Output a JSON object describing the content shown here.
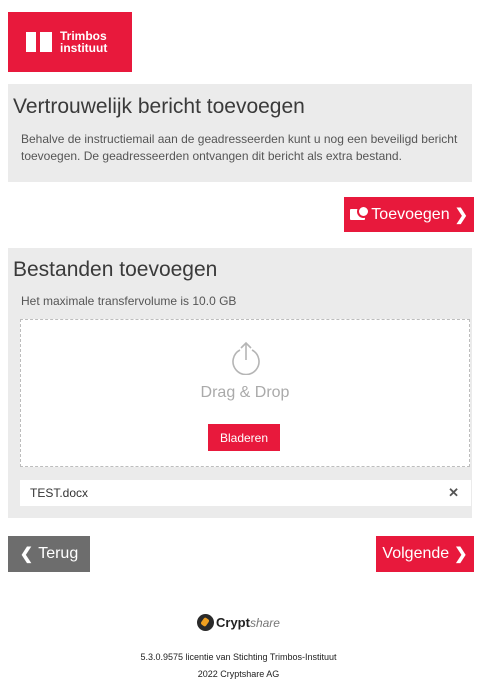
{
  "logo": {
    "line1": "Trimbos",
    "line2": "instituut"
  },
  "message_section": {
    "title": "Vertrouwelijk bericht toevoegen",
    "description": "Behalve de instructiemail aan de geadresseerden kunt u nog een beveiligd bericht toevoegen. De geadresseerden ontvangen dit bericht als extra bestand.",
    "add_button_label": "Toevoegen"
  },
  "files_section": {
    "title": "Bestanden toevoegen",
    "max_volume": "Het maximale transfervolume is 10.0 GB",
    "dropzone_text": "Drag & Drop",
    "browse_button_label": "Bladeren",
    "files": [
      {
        "name": "TEST.docx"
      }
    ]
  },
  "nav": {
    "back_label": "Terug",
    "next_label": "Volgende"
  },
  "footer": {
    "brand_bold": "Crypt",
    "brand_italic": "share",
    "version_line": "5.3.0.9575 licentie van Stichting Trimbos-Instituut",
    "copyright_line": "2022 Cryptshare AG"
  },
  "colors": {
    "accent": "#e8193c",
    "panel_bg": "#ebebeb",
    "back_button": "#6d6d6d"
  }
}
